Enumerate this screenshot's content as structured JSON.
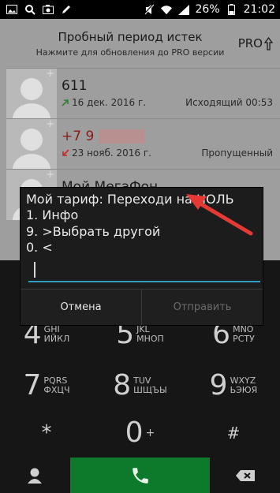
{
  "status_bar": {
    "battery": "26%",
    "time": "21:02",
    "icons": [
      "photo-icon",
      "search-icon",
      "camera-icon",
      "pen-icon",
      "mute-icon",
      "wifi-icon",
      "signal-icon",
      "battery-icon"
    ]
  },
  "pro_banner": {
    "title": "Пробный период истек",
    "subtitle": "Нажмите для обновления до PRO версии",
    "badge": "PRO"
  },
  "call_log": [
    {
      "name": "611",
      "date": "16 дек. 2016 г.",
      "type": "Исходящий 00:53",
      "direction": "outgoing",
      "color": "#2e7d32"
    },
    {
      "name": "+7 9",
      "date": "23 нояб. 2016 г.",
      "type": "Пропущенный",
      "direction": "missed",
      "color": "#c62828"
    },
    {
      "name": "Мой МегаФон",
      "date": "",
      "type": "",
      "direction": "",
      "color": ""
    }
  ],
  "ussd_dialog": {
    "lines": [
      "Мой тариф: Переходи на НОЛЬ",
      "1. Инфо",
      "9. >Выбрать другой",
      "0. <"
    ],
    "input_value": "",
    "cancel_label": "Отмена",
    "send_label": "Отправить",
    "accent": "#2d9ec4"
  },
  "dialpad": {
    "keys": [
      {
        "num": "4",
        "latin": "GHI",
        "cyrillic": "ИЙКЛ"
      },
      {
        "num": "5",
        "latin": "JKL",
        "cyrillic": "МНОП"
      },
      {
        "num": "6",
        "latin": "MNO",
        "cyrillic": "РСТУ"
      },
      {
        "num": "7",
        "latin": "PQRS",
        "cyrillic": "ФХЦЧ"
      },
      {
        "num": "8",
        "latin": "TUV",
        "cyrillic": "ШЩЪЫ"
      },
      {
        "num": "9",
        "latin": "WXYZ",
        "cyrillic": "ЬЭЮЯ"
      }
    ],
    "star": "*",
    "zero": "0",
    "zero_sub": "+",
    "hash": "#",
    "call_color": "#0c7a2a"
  }
}
